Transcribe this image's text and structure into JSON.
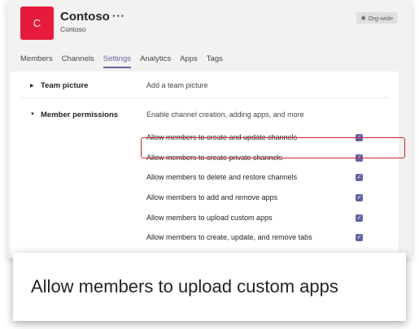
{
  "team": {
    "avatar_letter": "C",
    "name": "Contoso",
    "more": "···",
    "subtitle": "Contoso",
    "badge": "Org-wide"
  },
  "tabs": [
    "Members",
    "Channels",
    "Settings",
    "Analytics",
    "Apps",
    "Tags"
  ],
  "active_tab": "Settings",
  "sections": {
    "team_picture": {
      "title": "Team picture",
      "desc": "Add a team picture"
    },
    "member_permissions": {
      "title": "Member permissions",
      "desc": "Enable channel creation, adding apps, and more"
    }
  },
  "permissions": [
    {
      "label": "Allow members to create and update channels",
      "checked": true
    },
    {
      "label": "Allow members to create private channels",
      "checked": true
    },
    {
      "label": "Allow members to delete and restore channels",
      "checked": true
    },
    {
      "label": "Allow members to add and remove apps",
      "checked": true
    },
    {
      "label": "Allow members to upload custom apps",
      "checked": true
    },
    {
      "label": "Allow members to create, update, and remove tabs",
      "checked": true
    }
  ],
  "callout": "Allow members to upload custom apps",
  "colors": {
    "accent": "#6264a7",
    "avatar": "#e81a3c",
    "highlight": "#c4262e"
  }
}
